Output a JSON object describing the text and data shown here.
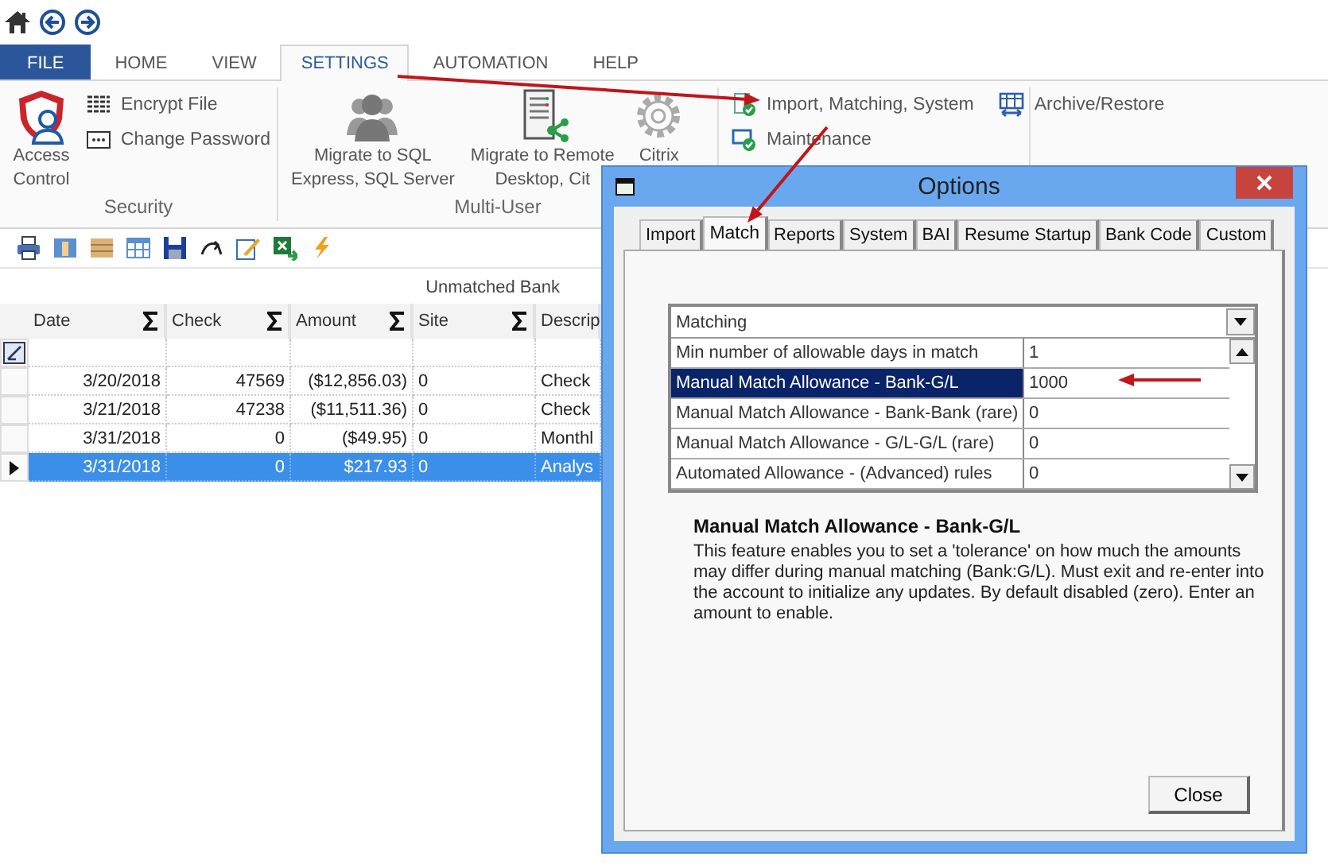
{
  "ribbon": {
    "tabs": [
      {
        "label": "FILE",
        "kind": "file",
        "selected": false
      },
      {
        "label": "HOME",
        "kind": "tab",
        "selected": false
      },
      {
        "label": "VIEW",
        "kind": "tab",
        "selected": false
      },
      {
        "label": "SETTINGS",
        "kind": "tab",
        "selected": true
      },
      {
        "label": "AUTOMATION",
        "kind": "tab",
        "selected": false
      },
      {
        "label": "HELP",
        "kind": "tab",
        "selected": false
      }
    ],
    "groups": [
      {
        "label": "Security",
        "items": [
          {
            "kind": "large",
            "lines": [
              "Access",
              "Control"
            ]
          },
          {
            "kind": "small",
            "label": "Encrypt File"
          },
          {
            "kind": "small",
            "label": "Change Password"
          }
        ]
      },
      {
        "label": "Multi-User",
        "items": [
          {
            "kind": "large",
            "lines": [
              "Migrate to SQL",
              "Express, SQL Server"
            ]
          },
          {
            "kind": "large",
            "lines": [
              "Migrate to Remote",
              "Desktop, Cit"
            ]
          },
          {
            "kind": "large",
            "lines": [
              "Citrix"
            ]
          }
        ]
      },
      {
        "items": [
          {
            "kind": "small",
            "label": "Import, Matching, System"
          },
          {
            "kind": "small",
            "label": "Maintenance"
          },
          {
            "kind": "small",
            "label": "Archive/Restore"
          }
        ]
      }
    ]
  },
  "grid": {
    "band": "Unmatched Bank",
    "columns": [
      "Date",
      "Check",
      "Amount",
      "Site",
      "Descrip"
    ],
    "rows": [
      {
        "cells": [
          "3/20/2018",
          "47569",
          "($12,856.03)",
          "0",
          "Check"
        ],
        "selected": false
      },
      {
        "cells": [
          "3/21/2018",
          "47238",
          "($11,511.36)",
          "0",
          "Check"
        ],
        "selected": false
      },
      {
        "cells": [
          "3/31/2018",
          "0",
          "($49.95)",
          "0",
          "Monthl"
        ],
        "selected": false
      },
      {
        "cells": [
          "3/31/2018",
          "0",
          "$217.93",
          "0",
          "Analys"
        ],
        "selected": true
      }
    ]
  },
  "dialog": {
    "title": "Options",
    "tabs": [
      {
        "label": "Import",
        "selected": false
      },
      {
        "label": "Match",
        "selected": true
      },
      {
        "label": "Reports",
        "selected": false
      },
      {
        "label": "System",
        "selected": false
      },
      {
        "label": "BAI",
        "selected": false
      },
      {
        "label": "Resume Startup",
        "selected": false
      },
      {
        "label": "Bank Code",
        "selected": false
      },
      {
        "label": "Custom",
        "selected": false
      }
    ],
    "property_grid": {
      "category": "Matching",
      "rows": [
        {
          "name": "Min number of allowable days in match",
          "value": "1",
          "selected": false
        },
        {
          "name": "Manual Match Allowance - Bank-G/L",
          "value": "1000",
          "selected": true
        },
        {
          "name": "Manual Match Allowance - Bank-Bank (rare)",
          "value": "0",
          "selected": false
        },
        {
          "name": "Manual Match Allowance - G/L-G/L (rare)",
          "value": "0",
          "selected": false
        },
        {
          "name": "Automated Allowance - (Advanced) rules",
          "value": "0",
          "selected": false
        }
      ]
    },
    "description": {
      "title": "Manual Match Allowance - Bank-G/L",
      "text": "This feature enables you to set a 'tolerance' on how much the amounts may differ during manual matching (Bank:G/L). Must exit and re-enter into the account to initialize any updates. By default disabled (zero).  Enter an amount to enable."
    },
    "buttons": [
      "Close"
    ]
  }
}
